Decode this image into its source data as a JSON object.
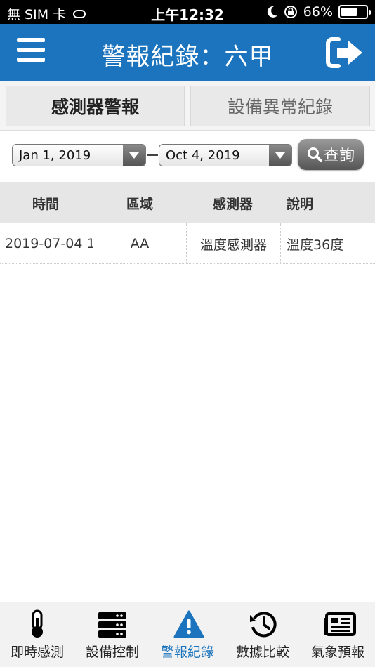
{
  "status_bar": {
    "carrier": "無 SIM 卡",
    "time": "上午12:32",
    "battery": "66%",
    "battery_level": 0.66
  },
  "header": {
    "title": "警報紀錄：六甲",
    "menu_icon": "hamburger-menu-icon",
    "logout_icon": "logout-icon"
  },
  "tabs": [
    {
      "label": "感測器警報",
      "active": true
    },
    {
      "label": "設備異常紀錄",
      "active": false
    }
  ],
  "filter": {
    "date_from": "Jan 1, 2019",
    "date_to": "Oct 4, 2019",
    "query_label": "查詢"
  },
  "table": {
    "columns": [
      "時間",
      "區域",
      "感測器",
      "說明"
    ],
    "rows": [
      [
        "2019-07-04 1",
        "AA",
        "溫度感測器",
        "溫度36度"
      ]
    ]
  },
  "bottom_nav": [
    {
      "label": "即時感測",
      "icon": "thermometer-icon",
      "active": false
    },
    {
      "label": "設備控制",
      "icon": "server-icon",
      "active": false
    },
    {
      "label": "警報紀錄",
      "icon": "warning-icon",
      "active": true
    },
    {
      "label": "數據比較",
      "icon": "history-icon",
      "active": false
    },
    {
      "label": "氣象預報",
      "icon": "newspaper-icon",
      "active": false
    }
  ],
  "colors": {
    "header_blue": "#1b74bd",
    "active_nav": "#1b74bd"
  }
}
